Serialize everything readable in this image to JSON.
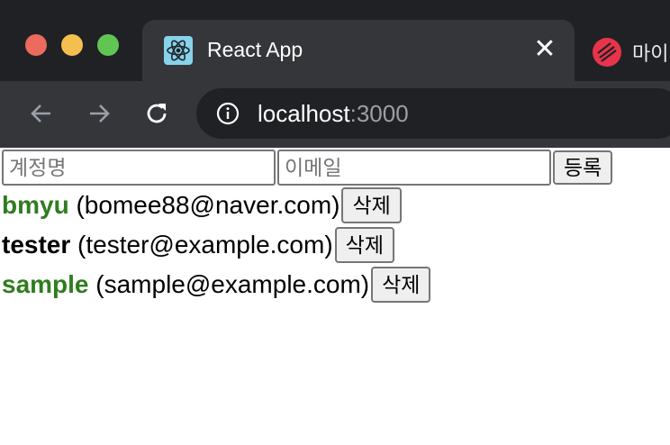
{
  "browser": {
    "active_tab": {
      "title": "React App",
      "close_glyph": "✕"
    },
    "inactive_tab": {
      "title": "마이"
    },
    "address": {
      "host": "localhost",
      "port": ":3000"
    }
  },
  "form": {
    "username_placeholder": "계정명",
    "email_placeholder": "이메일",
    "submit_label": "등록"
  },
  "users": [
    {
      "username": "bmyu",
      "email": "(bomee88@naver.com)",
      "color": "#2e7d1f",
      "delete_label": "삭제"
    },
    {
      "username": "tester",
      "email": "(tester@example.com)",
      "color": "#000000",
      "delete_label": "삭제"
    },
    {
      "username": "sample",
      "email": "(sample@example.com)",
      "color": "#2e7d1f",
      "delete_label": "삭제"
    }
  ]
}
